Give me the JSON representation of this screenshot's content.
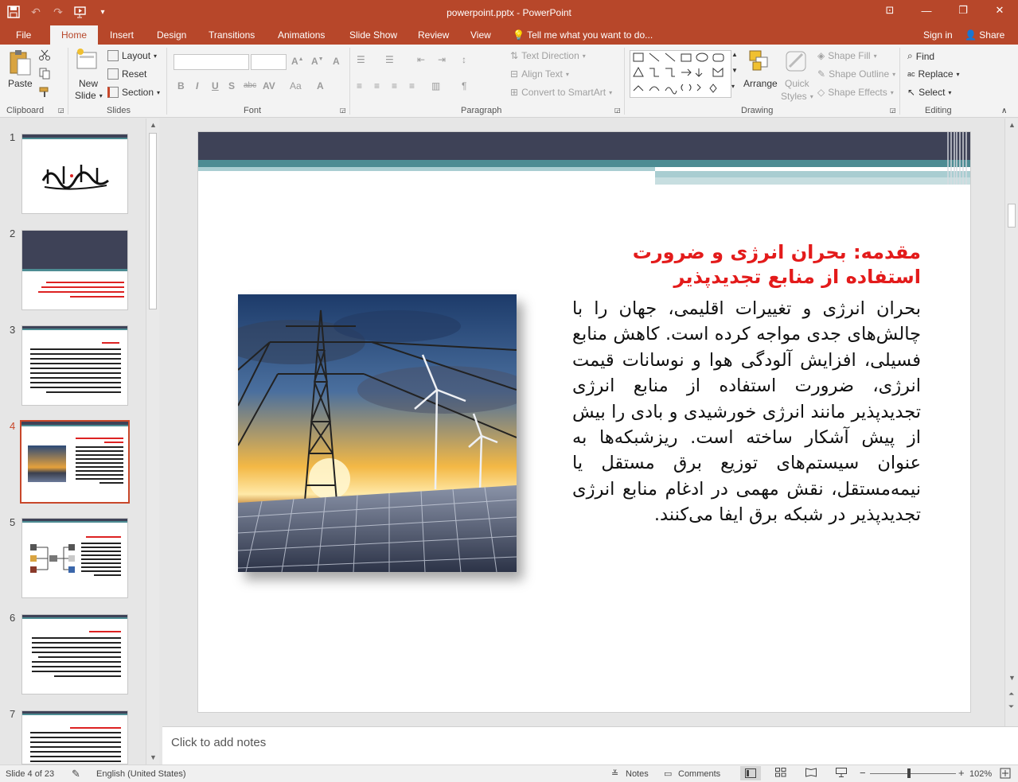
{
  "window": {
    "title": "powerpoint.pptx - PowerPoint",
    "minimize": "—",
    "restore": "❐",
    "close": "✕",
    "ribbon_display": "⊡"
  },
  "qat": {
    "save": "💾",
    "undo": "↶",
    "redo": "↷",
    "start": "▢",
    "customize": "▾"
  },
  "tabs": [
    {
      "label": "File"
    },
    {
      "label": "Home"
    },
    {
      "label": "Insert"
    },
    {
      "label": "Design"
    },
    {
      "label": "Transitions"
    },
    {
      "label": "Animations"
    },
    {
      "label": "Slide Show"
    },
    {
      "label": "Review"
    },
    {
      "label": "View"
    }
  ],
  "tell_me": "Tell me what you want to do...",
  "sign_in": "Sign in",
  "share": "Share",
  "ribbon": {
    "clipboard": {
      "label": "Clipboard",
      "paste": "Paste"
    },
    "slides": {
      "label": "Slides",
      "new_slide": "New",
      "new_slide2": "Slide",
      "layout": "Layout",
      "reset": "Reset",
      "section": "Section"
    },
    "font": {
      "label": "Font",
      "bold": "B",
      "italic": "I",
      "underline": "U",
      "shadow": "S",
      "strike": "abc",
      "aa": "Aa"
    },
    "paragraph": {
      "label": "Paragraph",
      "text_direction": "Text Direction",
      "align_text": "Align Text",
      "smartart": "Convert to SmartArt"
    },
    "drawing": {
      "label": "Drawing",
      "arrange": "Arrange",
      "quick": "Quick",
      "styles": "Styles",
      "shape_fill": "Shape Fill",
      "shape_outline": "Shape Outline",
      "shape_effects": "Shape Effects"
    },
    "editing": {
      "label": "Editing",
      "find": "Find",
      "replace": "Replace",
      "select": "Select"
    }
  },
  "thumbnails": [
    {
      "num": "1"
    },
    {
      "num": "2"
    },
    {
      "num": "3"
    },
    {
      "num": "4"
    },
    {
      "num": "5"
    },
    {
      "num": "6"
    },
    {
      "num": "7"
    }
  ],
  "slide": {
    "title": "مقدمه: بحران انرژی و ضرورت استفاده از منابع تجدیدپذیر",
    "body": "بحران انرژی و تغییرات اقلیمی، جهان را با چالش‌های جدی مواجه کرده است. کاهش منابع فسیلی، افزایش آلودگی هوا و نوسانات قیمت انرژی، ضرورت استفاده از منابع انرژی تجدیدپذیر مانند انرژی خورشیدی و بادی را بیش از پیش آشکار ساخته است. ریزشبکه‌ها به عنوان سیستم‌های توزیع برق مستقل یا نیمه‌مستقل، نقش مهمی در ادغام منابع انرژی تجدیدپذیر در شبکه برق ایفا می‌کنند."
  },
  "notes_placeholder": "Click to add notes",
  "status": {
    "slide_info": "Slide 4 of 23",
    "language": "English (United States)",
    "notes": "Notes",
    "comments": "Comments",
    "zoom": "102%",
    "minus": "−",
    "plus": "+"
  },
  "colors": {
    "accent": "#b7472a",
    "title_red": "#e31b1b",
    "slide_header": "#3e4257",
    "teal": "#4d8c93"
  }
}
